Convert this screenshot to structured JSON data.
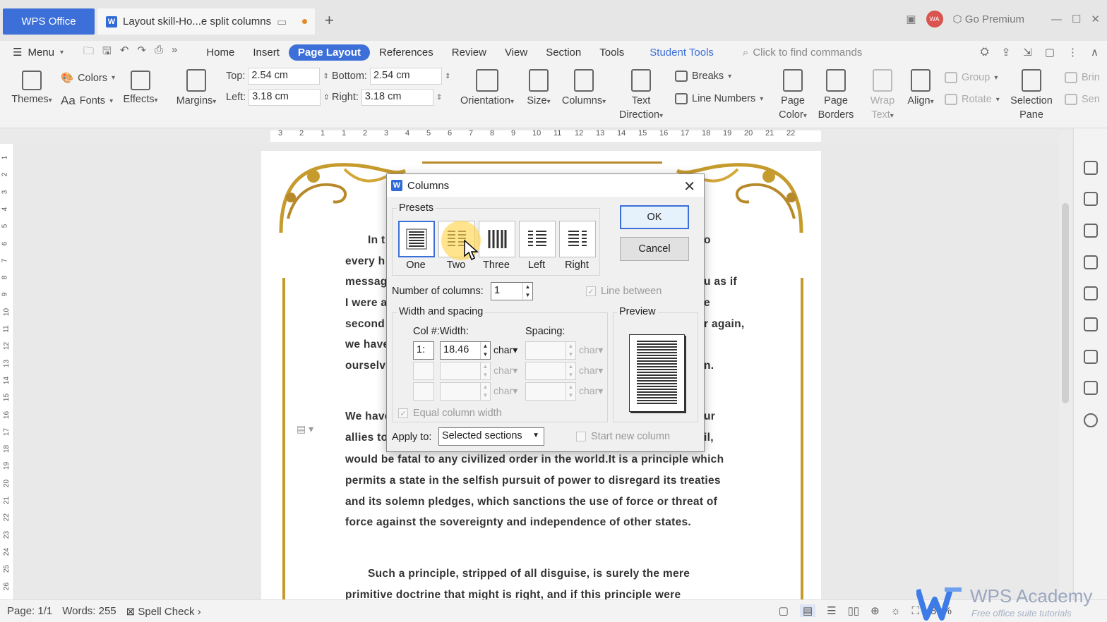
{
  "titlebar": {
    "app_tab": "WPS Office",
    "doc_tab": "Layout skill-Ho...e split columns",
    "avatar": "WA",
    "go_premium": "Go Premium"
  },
  "menubar": {
    "menu_label": "Menu",
    "tabs": [
      "Home",
      "Insert",
      "Page Layout",
      "References",
      "Review",
      "View",
      "Section",
      "Tools"
    ],
    "student_tools": "Student Tools",
    "find_placeholder": "Click to find commands"
  },
  "ribbon": {
    "themes": "Themes",
    "colors": "Colors",
    "fonts": "Fonts",
    "effects": "Effects",
    "margins": "Margins",
    "top_label": "Top:",
    "top_value": "2.54 cm",
    "bottom_label": "Bottom:",
    "bottom_value": "2.54 cm",
    "left_label": "Left:",
    "left_value": "3.18 cm",
    "right_label": "Right:",
    "right_value": "3.18 cm",
    "orientation": "Orientation",
    "size": "Size",
    "columns": "Columns",
    "text_direction_1": "Text",
    "text_direction_2": "Direction",
    "breaks": "Breaks",
    "line_numbers": "Line Numbers",
    "page_color_1": "Page",
    "page_color_2": "Color",
    "page_borders_1": "Page",
    "page_borders_2": "Borders",
    "wrap_text_1": "Wrap",
    "wrap_text_2": "Text",
    "align": "Align",
    "group": "Group",
    "rotate": "Rotate",
    "selection_pane_1": "Selection",
    "selection_pane_2": "Pane",
    "bring": "Brin",
    "send": "Sen"
  },
  "ruler": {
    "h_numbers": [
      "3",
      "2",
      "1",
      "1",
      "2",
      "3",
      "4",
      "5",
      "6",
      "7",
      "8",
      "9",
      "10",
      "11",
      "12",
      "13",
      "14",
      "15",
      "16",
      "17",
      "18",
      "19",
      "20",
      "21",
      "22"
    ],
    "v_numbers": [
      "1",
      "2",
      "3",
      "4",
      "5",
      "6",
      "7",
      "8",
      "9",
      "10",
      "11",
      "12",
      "13",
      "14",
      "15",
      "16",
      "17",
      "18",
      "19",
      "20",
      "21",
      "22",
      "23",
      "24",
      "25",
      "26"
    ]
  },
  "document": {
    "left_fragments": [
      "In t",
      "every h",
      "messag",
      "I were a",
      "second t",
      "we have",
      "ourselve"
    ],
    "right_fragments": [
      "o",
      "u as if",
      "e",
      "r again,",
      "n."
    ],
    "para2_first": [
      "We have",
      "allies to"
    ],
    "para2_right": [
      "ur",
      "il,"
    ],
    "para2_lines": [
      "would be fatal to any civilized order in the world.It is a principle which",
      "permits a state in the selfish pursuit of power to disregard its treaties",
      "and its solemn pledges, which sanctions the use of force or threat of",
      "force against the sovereignty and independence of other states."
    ],
    "para3_lines": [
      "Such a principle, stripped of all disguise, is surely the mere",
      "primitive doctrine that might is right, and if this principle were"
    ]
  },
  "dialog": {
    "title": "Columns",
    "presets_label": "Presets",
    "presets": [
      "One",
      "Two",
      "Three",
      "Left",
      "Right"
    ],
    "selected_preset": "One",
    "ok": "OK",
    "cancel": "Cancel",
    "num_columns_label": "Number of columns:",
    "num_columns_value": "1",
    "line_between": "Line between",
    "width_spacing_label": "Width and spacing",
    "col_width_header": "Col #:Width:",
    "spacing_header": "Spacing:",
    "row1_col": "1:",
    "row1_width": "18.46",
    "unit": "char",
    "equal_width": "Equal column width",
    "preview_label": "Preview",
    "apply_to_label": "Apply to:",
    "apply_to_value": "Selected sections",
    "start_new_column": "Start new column"
  },
  "statusbar": {
    "page": "Page: 1/1",
    "words": "Words: 255",
    "spell_check": "Spell Check",
    "zoom": "80%"
  },
  "watermark": {
    "title": "WPS Academy",
    "subtitle": "Free office suite tutorials"
  },
  "colors": {
    "accent": "#3d6fd8",
    "gold_border": "#c69b2e"
  }
}
